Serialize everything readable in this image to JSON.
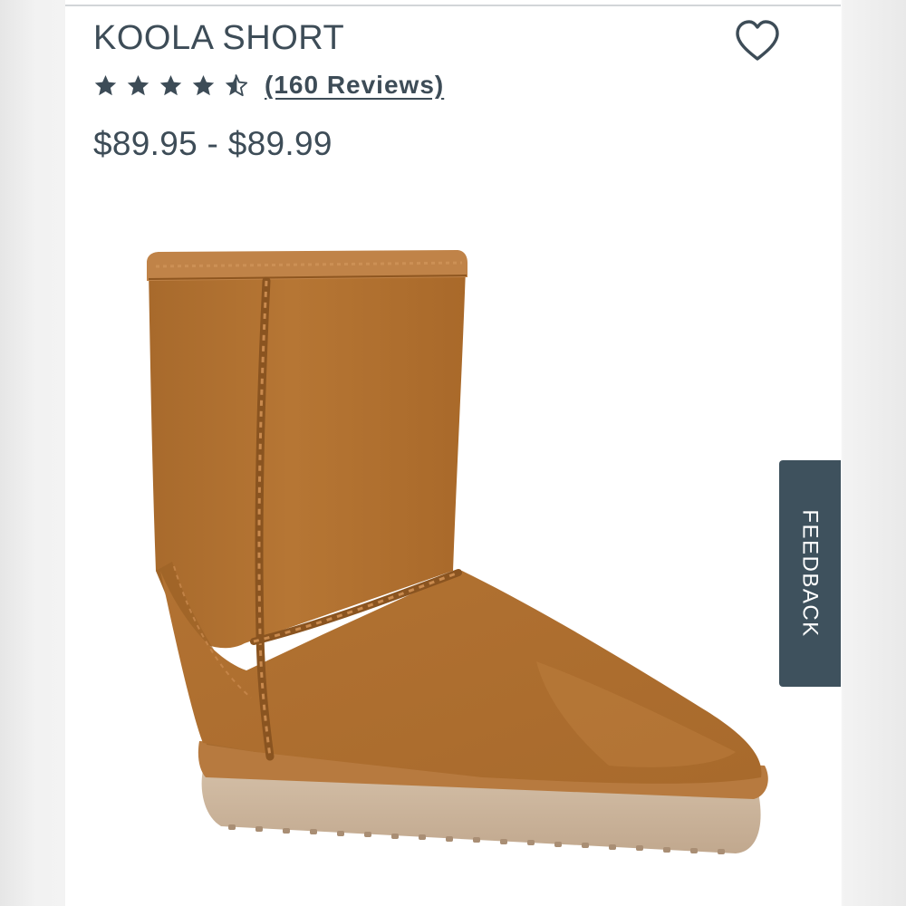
{
  "product": {
    "title": "KOOLA SHORT",
    "rating_value": 4.5,
    "rating_max": 5,
    "reviews_label": "(160 Reviews)",
    "price_range": "$89.95 - $89.99"
  },
  "feedback": {
    "label": "FEEDBACK"
  },
  "icons": {
    "wishlist": "heart-outline-icon",
    "star_full": "star-icon",
    "star_half": "star-half-icon"
  },
  "colors": {
    "text": "#3d4c57",
    "feedback_bg": "#3e515d",
    "boot_suede": "#b0712f",
    "sole": "#c9b29a"
  }
}
